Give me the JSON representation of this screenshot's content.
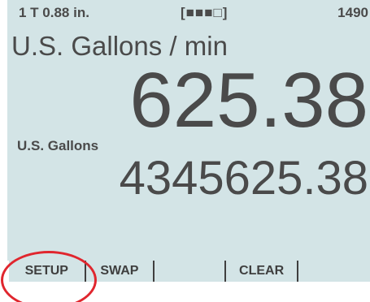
{
  "status_bar": {
    "left": "1 T 0.88 in.",
    "battery": "[■■■□]",
    "right": "1490"
  },
  "rate": {
    "unit": "U.S. Gallons / min",
    "value": "625.38"
  },
  "total": {
    "unit": "U.S. Gallons",
    "value": "4345625.38"
  },
  "softkeys": [
    {
      "label": "SETUP"
    },
    {
      "label": "SWAP"
    },
    {
      "label": ""
    },
    {
      "label": "CLEAR"
    },
    {
      "label": ""
    }
  ],
  "colors": {
    "lcd_background": "#d3e4e6",
    "text": "#4a4a4a",
    "softkey_border": "#3f3f3f",
    "highlight": "#e0262e"
  }
}
